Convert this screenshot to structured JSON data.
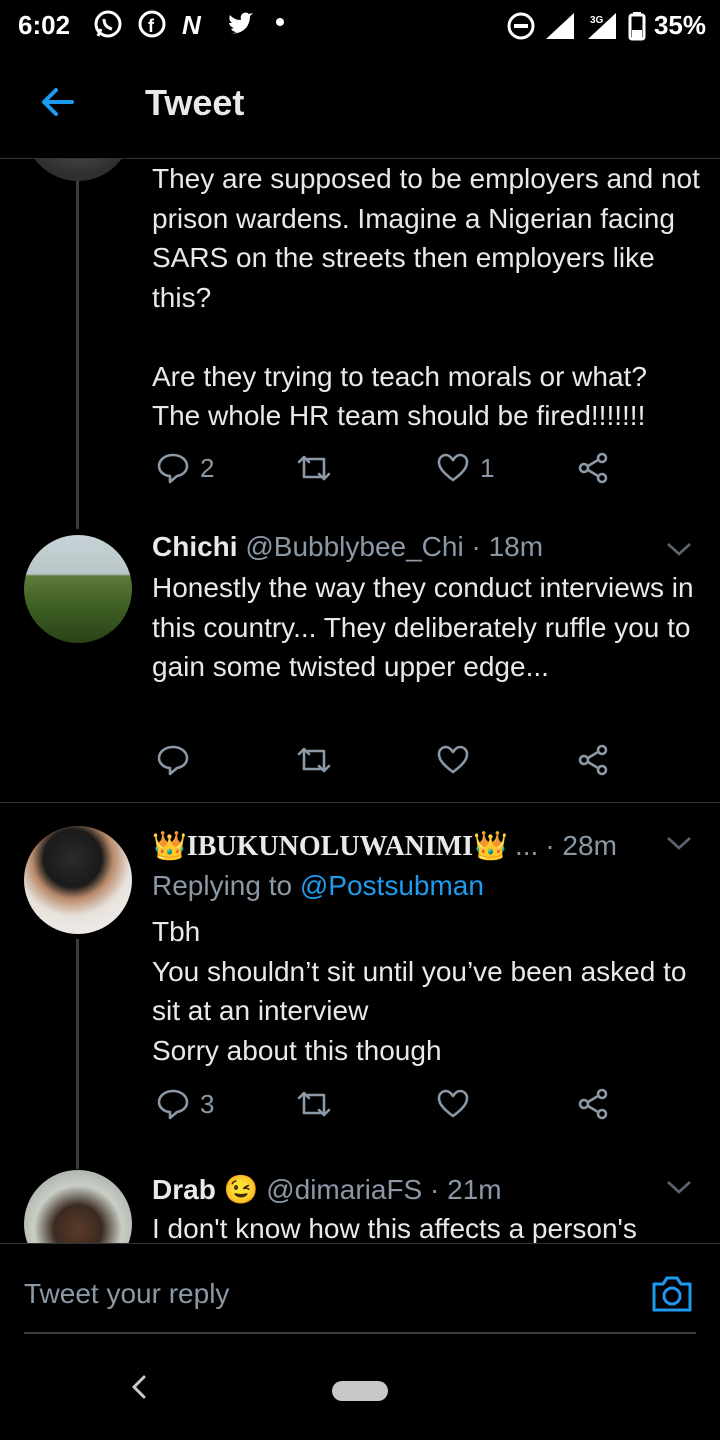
{
  "status_bar": {
    "time": "6:02",
    "battery": "35%",
    "network": "3G",
    "notif_icons": [
      "whatsapp-icon",
      "facebook-icon",
      "news-icon",
      "twitter-icon"
    ]
  },
  "header": {
    "title": "Tweet"
  },
  "tweets": [
    {
      "text": "They are supposed to be employers and not prison wardens. Imagine a Nigerian facing SARS on the streets then employers like this?\n\nAre they trying to teach morals or what? The whole HR team should be fired!!!!!!!",
      "replies": "2",
      "retweets": "",
      "likes": "1"
    },
    {
      "name": "Chichi",
      "handle": "@Bubblybee_Chi",
      "time": "· 18m",
      "text": "Honestly the way they conduct interviews in this country... They deliberately ruffle you to gain some twisted upper edge...",
      "replies": "",
      "retweets": "",
      "likes": ""
    },
    {
      "name": "👑IBUKUNOLUWANIMI👑",
      "ellipsis": "...",
      "time": "· 28m",
      "replying_label": "Replying to",
      "replying_to": "@Postsubman",
      "text": "Tbh\nYou shouldn’t sit until you’ve been asked to sit at an interview\nSorry about this though",
      "replies": "3",
      "retweets": "",
      "likes": ""
    },
    {
      "name": "Drab 😉",
      "handle": "@dimariaFS",
      "time": "· 21m",
      "text": "I don't know how this affects a person's"
    }
  ],
  "reply_bar": {
    "placeholder": "Tweet your reply"
  },
  "colors": {
    "accent": "#1d9bf0",
    "muted": "#8b98a5",
    "background": "#000000"
  }
}
